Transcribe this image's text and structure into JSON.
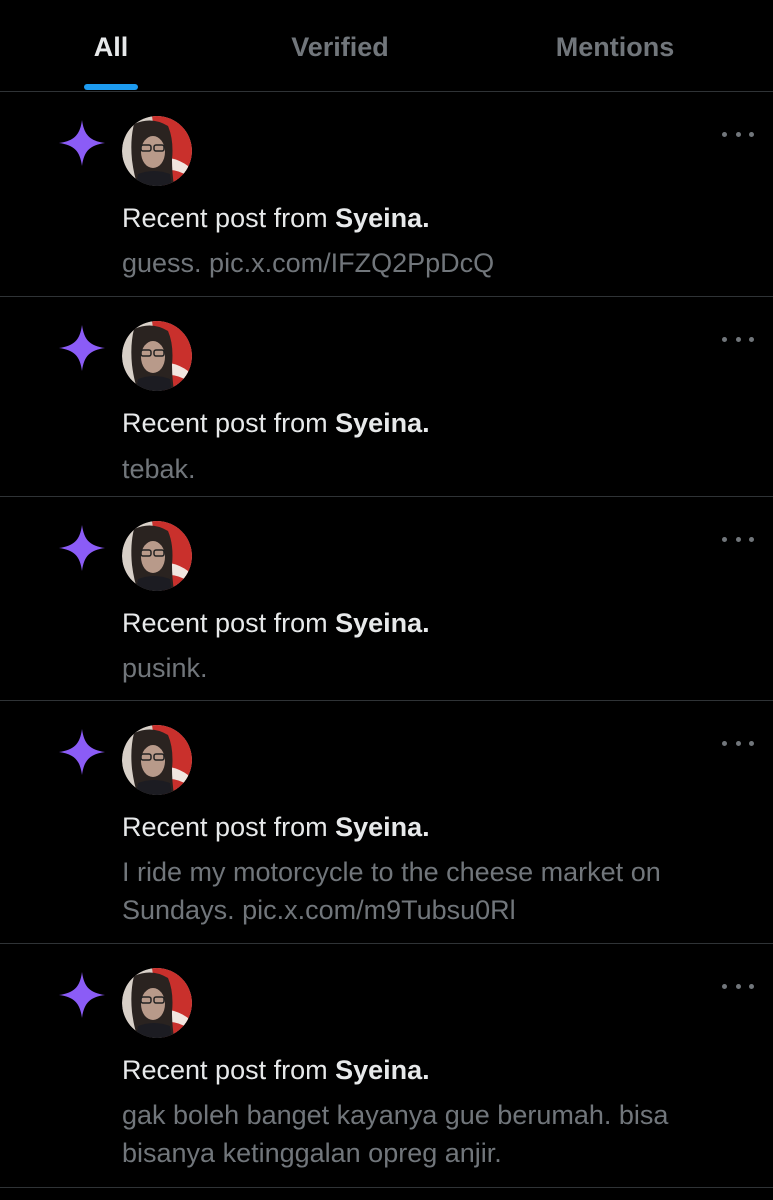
{
  "tabs": [
    {
      "label": "All",
      "active": true
    },
    {
      "label": "Verified",
      "active": false
    },
    {
      "label": "Mentions",
      "active": false
    }
  ],
  "colors": {
    "background": "#000000",
    "divider": "#2f3336",
    "tab_indicator": "#1d9bf0",
    "star": "#8b5cf6",
    "primary_text": "#e7e9ea",
    "secondary_text": "#71767b"
  },
  "notifications": [
    {
      "icon": "sparkle-star-icon",
      "prefix": "Recent post from ",
      "author": "Syeina.",
      "snippet": "guess. pic.x.com/IFZQ2PpDcQ"
    },
    {
      "icon": "sparkle-star-icon",
      "prefix": "Recent post from ",
      "author": "Syeina.",
      "snippet": "tebak."
    },
    {
      "icon": "sparkle-star-icon",
      "prefix": "Recent post from ",
      "author": "Syeina.",
      "snippet": "pusink."
    },
    {
      "icon": "sparkle-star-icon",
      "prefix": "Recent post from ",
      "author": "Syeina.",
      "snippet": "I ride my motorcycle to the cheese market on Sundays. pic.x.com/m9Tubsu0Rl"
    },
    {
      "icon": "sparkle-star-icon",
      "prefix": "Recent post from ",
      "author": "Syeina.",
      "snippet": "gak boleh banget kayanya gue berumah. bisa bisanya ketinggalan opreg anjir."
    }
  ]
}
